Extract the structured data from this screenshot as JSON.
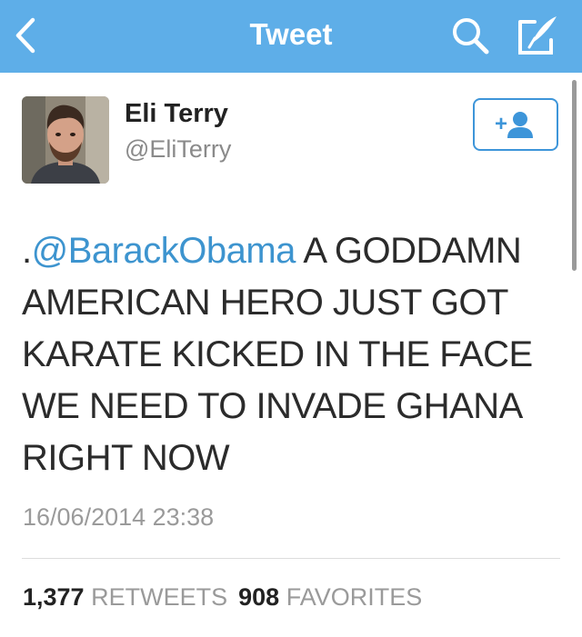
{
  "nav": {
    "title": "Tweet",
    "bar_color": "#5eaee8",
    "back_icon": "chevron-left-icon",
    "search_icon": "search-icon",
    "compose_icon": "compose-icon"
  },
  "tweet": {
    "display_name": "Eli Terry",
    "username": "@EliTerry",
    "prefix": ".",
    "mention": "@BarackObama",
    "body": " A GODDAMN AMERICAN HERO JUST GOT KARATE KICKED IN THE FACE WE NEED TO INVADE GHANA RIGHT NOW",
    "timestamp": "16/06/2014 23:38",
    "mention_color": "#3d94cf"
  },
  "follow_button": {
    "icon": "add-user-icon",
    "color": "#3d95d9"
  },
  "stats": {
    "retweets_count": "1,377",
    "retweets_label": "RETWEETS",
    "favorites_count": "908",
    "favorites_label": "FAVORITES"
  }
}
